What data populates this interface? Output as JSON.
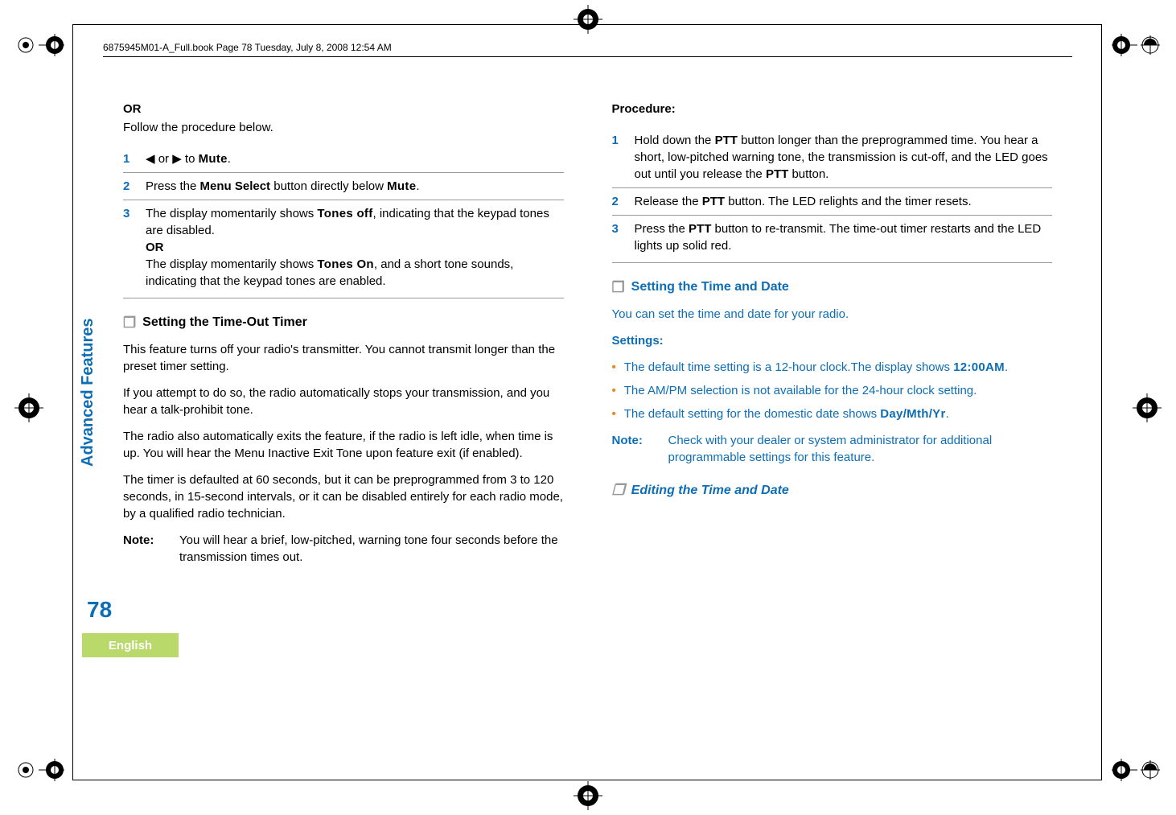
{
  "header": "6875945M01-A_Full.book  Page 78  Tuesday, July 8, 2008  12:54 AM",
  "sidebar_label": "Advanced Features",
  "page_number": "78",
  "language": "English",
  "left": {
    "or_label": "OR",
    "follow": "Follow the procedure below.",
    "steps": [
      {
        "num": "1",
        "pre": "",
        "arrows": "◀ or ▶ to ",
        "mono": "Mute",
        "post": "."
      },
      {
        "num": "2",
        "pre": "Press the ",
        "bold": "Menu Select",
        "mid": " button directly below ",
        "mono": "Mute",
        "post": "."
      },
      {
        "num": "3",
        "pre": "The display momentarily shows ",
        "mono": "Tones off",
        "post": ", indicating that the keypad tones are disabled.",
        "or": "OR",
        "line2_pre": "The display momentarily shows ",
        "line2_mono": "Tones On",
        "line2_post": ", and a short tone sounds, indicating that the keypad tones are enabled."
      }
    ],
    "section_title": "Setting the Time-Out Timer",
    "para1": "This feature turns off your radio's transmitter. You cannot transmit longer than the preset timer setting.",
    "para2": "If you attempt to do so, the radio automatically stops your transmission, and you hear a talk-prohibit tone.",
    "para3": "The radio also automatically exits the feature, if the radio is left idle, when time is up. You will hear the Menu Inactive Exit Tone upon feature exit (if enabled).",
    "para4": "The timer is defaulted at 60 seconds, but it can be preprogrammed from 3 to 120 seconds, in 15-second intervals, or it can be disabled entirely for each radio mode, by a qualified radio technician.",
    "note_label": "Note:",
    "note_text": "You will hear a brief, low-pitched, warning tone four seconds before the transmission times out."
  },
  "right": {
    "proc_label": "Procedure:",
    "steps": [
      {
        "num": "1",
        "pre": "Hold down the ",
        "bold1": "PTT",
        "mid1": " button longer than the preprogrammed time. You hear a short, low-pitched warning tone, the transmission is cut-off, and the LED goes out until you release the ",
        "bold2": "PTT",
        "post": " button."
      },
      {
        "num": "2",
        "pre": "Release the ",
        "bold1": "PTT",
        "post": " button. The LED relights and the timer resets."
      },
      {
        "num": "3",
        "pre": "Press the ",
        "bold1": "PTT",
        "post": " button to re-transmit. The time-out timer restarts and the LED lights up solid red."
      }
    ],
    "section_title": "Setting the Time and Date",
    "intro": "You can set the time and date for your radio.",
    "settings_label": "Settings:",
    "bullets": [
      {
        "pre": "The default time setting is a 12-hour clock.The display shows ",
        "mono": "12:00AM",
        "post": "."
      },
      {
        "text": "The AM/PM selection is not available for the 24-hour clock setting."
      },
      {
        "pre": "The default setting for the domestic date shows ",
        "mono": "Day/Mth/Yr",
        "post": "."
      }
    ],
    "note_label": "Note:",
    "note_text": "Check with your dealer or system administrator for additional programmable settings for this feature.",
    "subsection_title": "Editing the Time and Date"
  }
}
